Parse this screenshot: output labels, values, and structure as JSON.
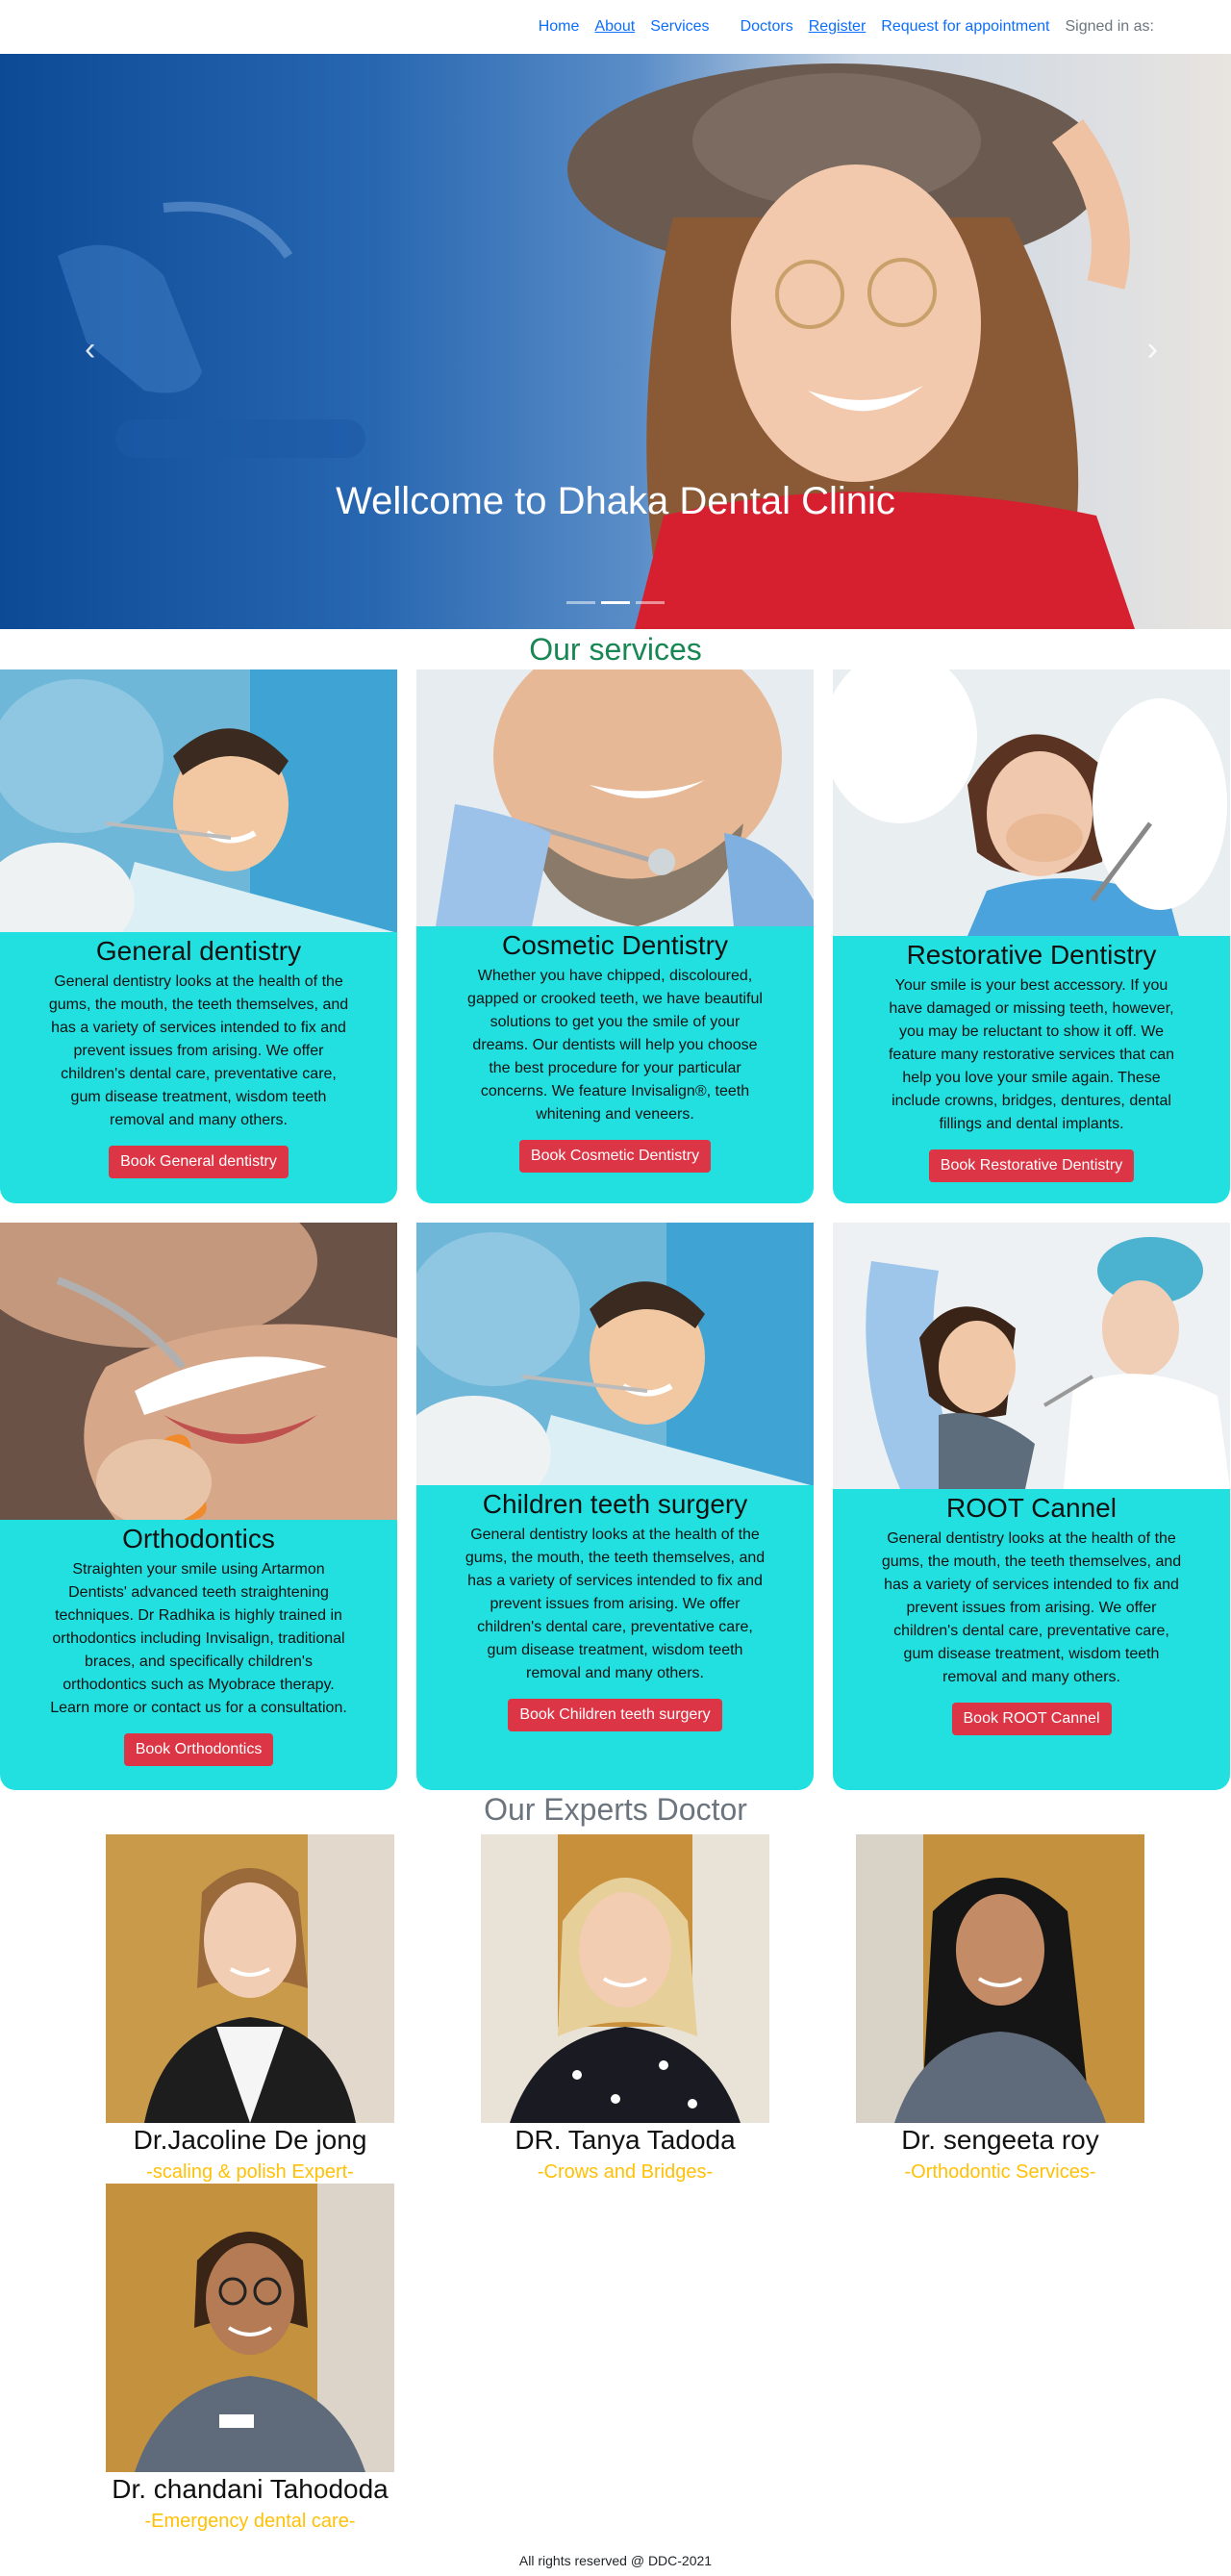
{
  "nav": {
    "items": [
      "Home",
      "About",
      "Services",
      "Doctors",
      "Register",
      "Request for appointment"
    ],
    "signed_in": "Signed in as:"
  },
  "hero": {
    "title": "Wellcome to Dhaka Dental Clinic",
    "prev_icon": "chevron-left-icon",
    "next_icon": "chevron-right-icon",
    "slides": 3,
    "active_slide": 2
  },
  "services": {
    "title": "Our services",
    "cards": [
      {
        "title": "General dentistry",
        "text": "General dentistry looks at the health of the gums, the mouth, the teeth themselves, and has a variety of services intended to fix and prevent issues from arising. We offer children's dental care, preventative care, gum disease treatment, wisdom teeth removal and many others.",
        "button": "Book General dentistry"
      },
      {
        "title": "Cosmetic Dentistry",
        "text": "Whether you have chipped, discoloured, gapped or crooked teeth, we have beautiful solutions to get you the smile of your dreams. Our dentists will help you choose the best procedure for your particular concerns. We feature Invisalign®, teeth whitening and veneers.",
        "button": "Book Cosmetic Dentistry"
      },
      {
        "title": "Restorative Dentistry",
        "text": "Your smile is your best accessory. If you have damaged or missing teeth, however, you may be reluctant to show it off. We feature many restorative services that can help you love your smile again. These include crowns, bridges, dentures, dental fillings and dental implants.",
        "button": "Book Restorative Dentistry"
      },
      {
        "title": "Orthodontics",
        "text": "Straighten your smile using Artarmon Dentists' advanced teeth straightening techniques. Dr Radhika is highly trained in orthodontics including Invisalign, traditional braces, and specifically children's orthodontics such as Myobrace therapy. Learn more or contact us for a consultation.",
        "button": "Book Orthodontics"
      },
      {
        "title": "Children teeth surgery",
        "text": "General dentistry looks at the health of the gums, the mouth, the teeth themselves, and has a variety of services intended to fix and prevent issues from arising. We offer children's dental care, preventative care, gum disease treatment, wisdom teeth removal and many others.",
        "button": "Book Children teeth surgery"
      },
      {
        "title": "ROOT Cannel",
        "text": "General dentistry looks at the health of the gums, the mouth, the teeth themselves, and has a variety of services intended to fix and prevent issues from arising. We offer children's dental care, preventative care, gum disease treatment, wisdom teeth removal and many others.",
        "button": "Book ROOT Cannel"
      }
    ]
  },
  "doctors": {
    "title": "Our Experts Doctor",
    "list": [
      {
        "name": "Dr.Jacoline De jong",
        "spec": "-scaling & polish Expert-"
      },
      {
        "name": "DR. Tanya Tadoda",
        "spec": "-Crows and Bridges-"
      },
      {
        "name": "Dr. sengeeta roy",
        "spec": "-Orthodontic Services-"
      },
      {
        "name": "Dr. chandani Tahododa",
        "spec": "-Emergency dental care-"
      }
    ]
  },
  "footer": "All rights reserved @ DDC-2021",
  "colors": {
    "card_bg": "#22e0e0",
    "button": "#dc3545",
    "services_title": "#198754",
    "doctors_title": "#6c757d",
    "spec": "#ffc107",
    "link": "#0d6efd"
  }
}
